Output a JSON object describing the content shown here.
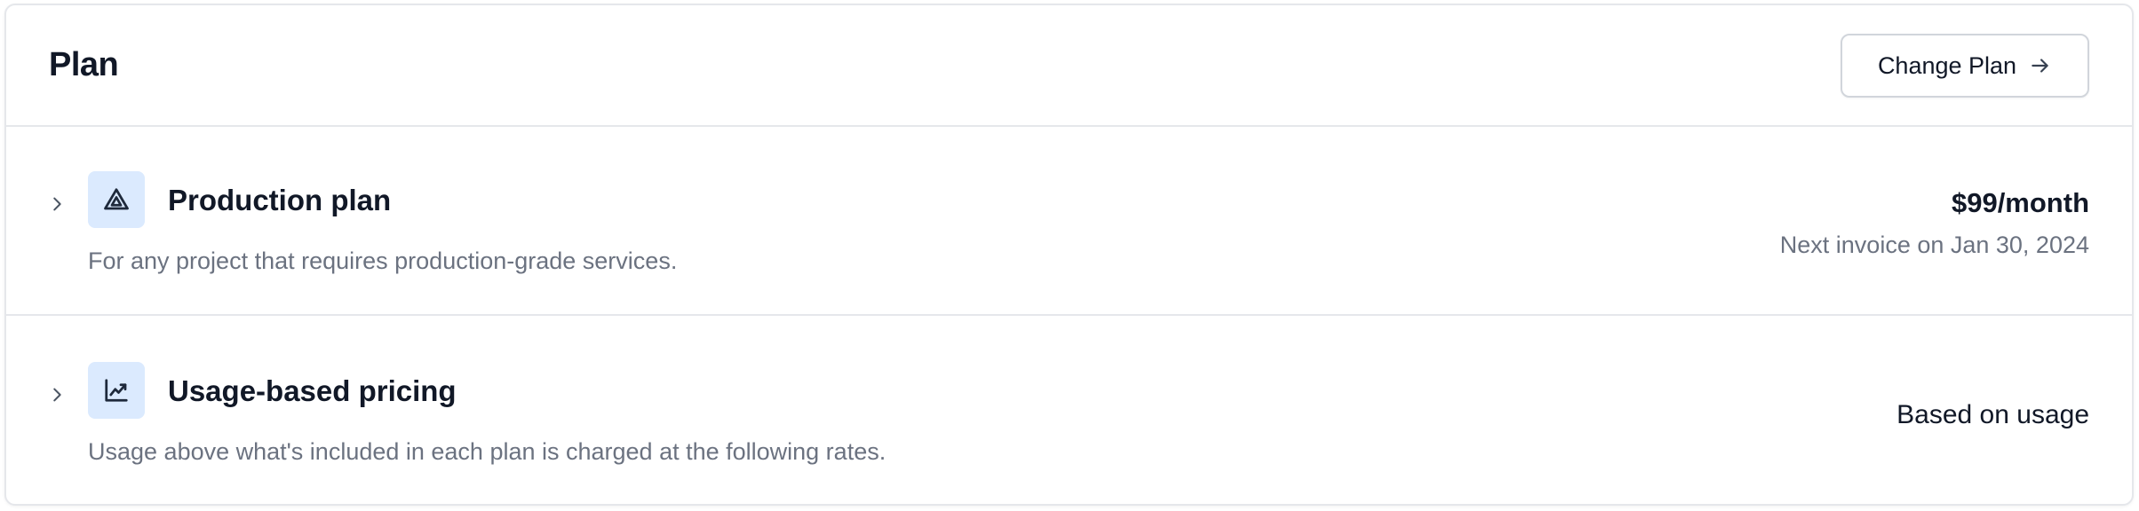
{
  "header": {
    "title": "Plan",
    "change_plan_label": "Change Plan"
  },
  "plans": [
    {
      "title": "Production plan",
      "description": "For any project that requires production-grade services.",
      "price": "$99/month",
      "invoice": "Next invoice on Jan 30, 2024",
      "icon": "triangle-icon"
    },
    {
      "title": "Usage-based pricing",
      "description": "Usage above what's included in each plan is charged at the following rates.",
      "right_label": "Based on usage",
      "icon": "chart-line-icon"
    }
  ],
  "colors": {
    "accent_bg": "#dbeafe",
    "icon_color": "#1e293b",
    "muted_text": "#6b7280",
    "border": "#e5e7eb"
  }
}
